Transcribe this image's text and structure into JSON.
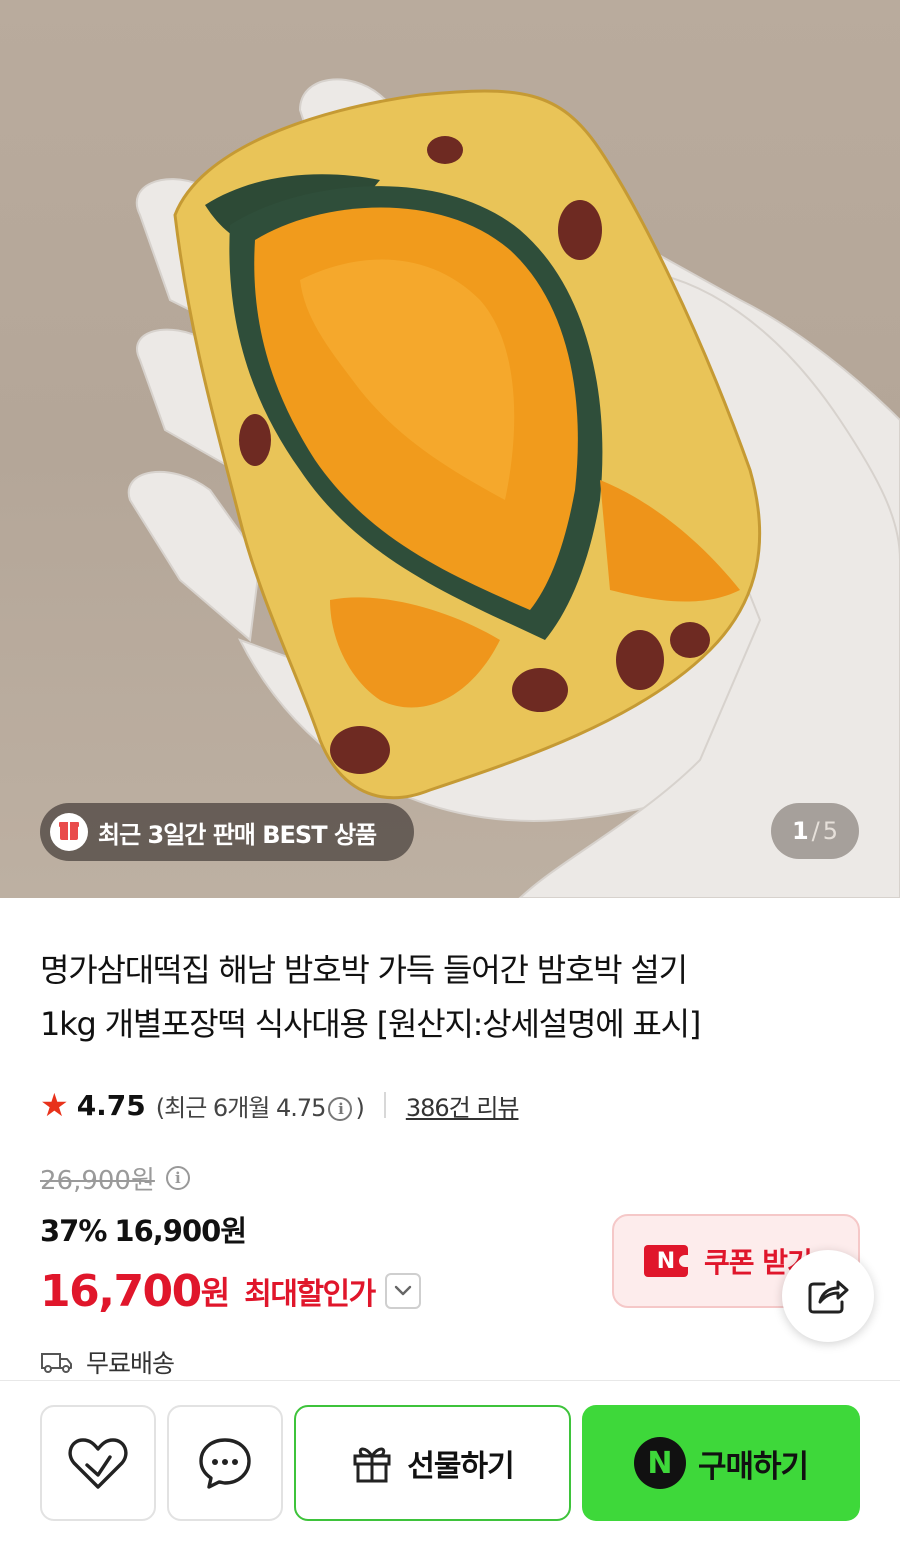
{
  "hero": {
    "best_badge": "최근 3일간 판매 BEST 상품",
    "pager": {
      "current": "1",
      "separator": "/",
      "total": "5"
    }
  },
  "product": {
    "title_line1": "명가삼대떡집 해남 밤호박 가득 들어간 밤호박 설기",
    "title_line2": "1kg 개별포장떡 식사대용 [원산지:상세설명에 표시]",
    "rating": {
      "score": "4.75",
      "recent_prefix": "(최근 6개월 4.75",
      "recent_suffix": ")",
      "review_link": "386건 리뷰"
    },
    "price": {
      "original": "26,900원",
      "discount_percent": "37%",
      "discounted": "16,900원",
      "final_number": "16,700",
      "final_unit": "원",
      "max_discount_label": "최대할인가"
    },
    "coupon_label": "쿠폰 받기",
    "shipping": "무료배송"
  },
  "bottom_bar": {
    "gift_label": "선물하기",
    "buy_label": "구매하기",
    "npay_letter": "N"
  },
  "icons": {
    "star": "star-icon",
    "info": "info-icon",
    "share": "share-icon",
    "truck": "truck-icon",
    "heart": "heart-icon",
    "chat": "chat-icon",
    "gift": "gift-icon"
  },
  "colors": {
    "accent_red": "#e0162b",
    "star_red": "#e8321b",
    "npay_green": "#3ed83a",
    "gift_border_green": "#3ec33b"
  }
}
